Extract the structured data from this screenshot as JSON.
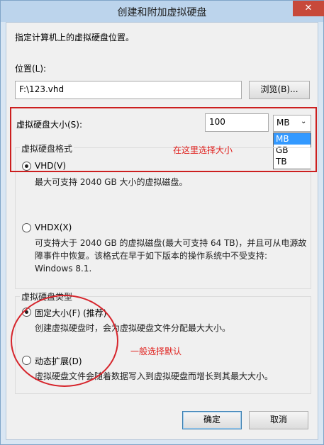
{
  "window": {
    "title": "创建和附加虚拟硬盘",
    "close_glyph": "✕"
  },
  "location": {
    "intro": "指定计算机上的虚拟硬盘位置。",
    "label": "位置(L):",
    "value": "F:\\123.vhd",
    "browse_label": "浏览(B)..."
  },
  "size": {
    "label": "虚拟硬盘大小(S):",
    "value": "100",
    "unit_selected": "MB",
    "unit_options": [
      "MB",
      "GB",
      "TB"
    ],
    "annotation": "在这里选择大小"
  },
  "format": {
    "group_label": "虚拟硬盘格式",
    "vhd_label": "VHD(V)",
    "vhd_desc": "最大可支持 2040 GB 大小的虚拟磁盘。",
    "vhdx_label": "VHDX(X)",
    "vhdx_desc": [
      "可支持大于 2040 GB 的虚拟磁盘(最大可支持 64 TB)，并且可从电源故",
      "障事件中恢复。该格式在早于如下版本的操作系统中不受支持:",
      "Windows 8.1."
    ]
  },
  "type": {
    "group_label": "虚拟硬盘类型",
    "fixed_label": "固定大小(F) (推荐)",
    "fixed_desc": "创建虚拟硬盘时，会为虚拟硬盘文件分配最大大小。",
    "dynamic_label": "动态扩展(D)",
    "dynamic_desc": "虚拟硬盘文件会随着数据写入到虚拟硬盘而增长到其最大大小。",
    "annotation": "一般选择默认"
  },
  "footer": {
    "ok_label": "确定",
    "cancel_label": "取消"
  },
  "colors": {
    "accent": "#3399ff",
    "annotation_red": "#e0221f"
  }
}
